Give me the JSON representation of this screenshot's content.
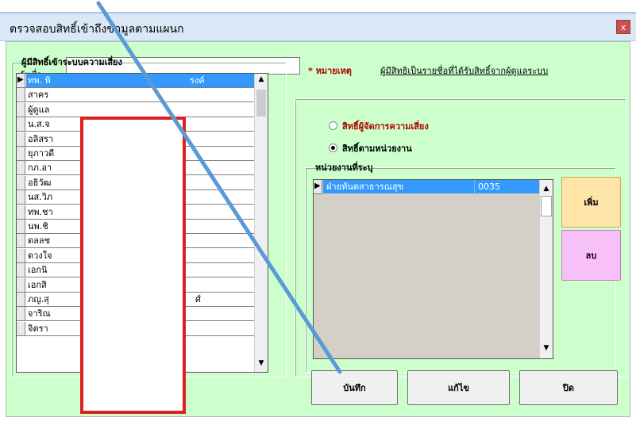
{
  "window": {
    "title": "ตรวจสอบสิทธิ์เข้าถึงข้อมูลตามแผนก",
    "close_glyph": "x"
  },
  "search": {
    "label": "ค้นชื่อ",
    "value": ""
  },
  "note": {
    "label": "* หมายเหตุ",
    "text": "ผู้มีสิทธิเป็นรายชื่อที่ได้รับสิทธิ์จากผู้ดูแลระบบ"
  },
  "users_panel": {
    "legend": "ผู้มีสิทธิ์เข้าระบบความเสี่ยง",
    "rows": [
      "ทพ. พิ",
      "สาคร",
      "ผู้ดูแล",
      "น.ส.จ",
      "อลิสรา",
      "ยุภาวดี",
      "กภ.อา",
      "อธิวัฒ",
      "นส.วิภ",
      "ทพ.ชา",
      "นพ.ชิ",
      "ดลลช",
      "ดวงใจ",
      "เอกนิ",
      "เอกสิ",
      "ภญ.สุ",
      "จาริณ",
      "จิตรา"
    ],
    "visible_tails": {
      "row0": "รงค์",
      "row15": "ศ์"
    }
  },
  "rights": {
    "option_admin": "สิทธิ์ผู้จัดการความเสี่ยง",
    "option_unit": "สิทธิ์ตามหน่วยงาน",
    "selected": "unit"
  },
  "units_panel": {
    "legend": "หน่วยงานที่ระบุ",
    "rows": [
      {
        "name": "ฝ่ายทันตสาธารณสุข",
        "code": "0035"
      }
    ]
  },
  "buttons": {
    "add": "เพิ่ม",
    "delete": "ลบ",
    "save": "บันทึก",
    "edit": "แก้ไข",
    "close": "ปิด"
  },
  "colors": {
    "client_bg": "#ccffcc",
    "selection": "#3399ff",
    "add_button": "#ffe4a8",
    "delete_button": "#f8c0f8",
    "note_red": "#b00000",
    "redaction_box": "#e02020",
    "annotation_line": "#5b9bd5"
  },
  "icons": {
    "close": "close-icon",
    "row_pointer": "row-pointer-icon",
    "scroll_up": "scroll-up-icon",
    "scroll_down": "scroll-down-icon"
  }
}
